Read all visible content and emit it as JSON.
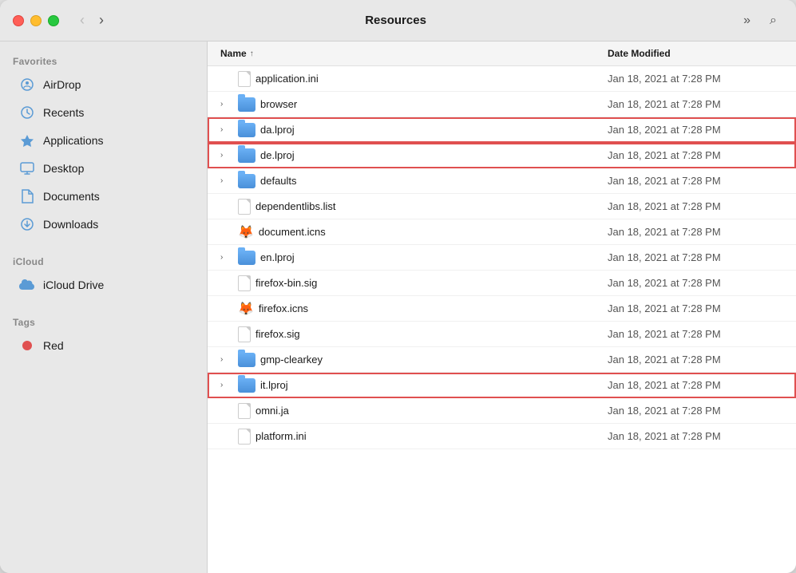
{
  "window": {
    "title": "Resources",
    "traffic_lights": {
      "close": "close",
      "minimize": "minimize",
      "maximize": "maximize"
    }
  },
  "titlebar": {
    "back_label": "‹",
    "forward_label": "›",
    "title": "Resources",
    "more_label": "»",
    "search_label": "⌕"
  },
  "sidebar": {
    "favorites_label": "Favorites",
    "icloud_label": "iCloud",
    "tags_label": "Tags",
    "items": [
      {
        "id": "airdrop",
        "label": "AirDrop",
        "icon": "airdrop"
      },
      {
        "id": "recents",
        "label": "Recents",
        "icon": "recents"
      },
      {
        "id": "applications",
        "label": "Applications",
        "icon": "applications"
      },
      {
        "id": "desktop",
        "label": "Desktop",
        "icon": "desktop"
      },
      {
        "id": "documents",
        "label": "Documents",
        "icon": "documents"
      },
      {
        "id": "downloads",
        "label": "Downloads",
        "icon": "downloads"
      }
    ],
    "icloud_items": [
      {
        "id": "icloud-drive",
        "label": "iCloud Drive",
        "icon": "icloud"
      }
    ],
    "tag_items": [
      {
        "id": "red",
        "label": "Red",
        "icon": "red-dot"
      }
    ]
  },
  "file_list": {
    "col_name": "Name",
    "col_date": "Date Modified",
    "sort_indicator": "↑",
    "rows": [
      {
        "id": 1,
        "name": "application.ini",
        "type": "doc",
        "expandable": false,
        "date": "Jan 18, 2021 at 7:28 PM",
        "highlighted": false
      },
      {
        "id": 2,
        "name": "browser",
        "type": "folder",
        "expandable": true,
        "date": "Jan 18, 2021 at 7:28 PM",
        "highlighted": false
      },
      {
        "id": 3,
        "name": "da.lproj",
        "type": "folder",
        "expandable": true,
        "date": "Jan 18, 2021 at 7:28 PM",
        "highlighted": true
      },
      {
        "id": 4,
        "name": "de.lproj",
        "type": "folder",
        "expandable": true,
        "date": "Jan 18, 2021 at 7:28 PM",
        "highlighted": true
      },
      {
        "id": 5,
        "name": "defaults",
        "type": "folder",
        "expandable": true,
        "date": "Jan 18, 2021 at 7:28 PM",
        "highlighted": false
      },
      {
        "id": 6,
        "name": "dependentlibs.list",
        "type": "doc",
        "expandable": false,
        "date": "Jan 18, 2021 at 7:28 PM",
        "highlighted": false
      },
      {
        "id": 7,
        "name": "document.icns",
        "type": "firefox",
        "expandable": false,
        "date": "Jan 18, 2021 at 7:28 PM",
        "highlighted": false
      },
      {
        "id": 8,
        "name": "en.lproj",
        "type": "folder",
        "expandable": true,
        "date": "Jan 18, 2021 at 7:28 PM",
        "highlighted": false
      },
      {
        "id": 9,
        "name": "firefox-bin.sig",
        "type": "doc",
        "expandable": false,
        "date": "Jan 18, 2021 at 7:28 PM",
        "highlighted": false
      },
      {
        "id": 10,
        "name": "firefox.icns",
        "type": "firefox",
        "expandable": false,
        "date": "Jan 18, 2021 at 7:28 PM",
        "highlighted": false
      },
      {
        "id": 11,
        "name": "firefox.sig",
        "type": "doc",
        "expandable": false,
        "date": "Jan 18, 2021 at 7:28 PM",
        "highlighted": false
      },
      {
        "id": 12,
        "name": "gmp-clearkey",
        "type": "folder",
        "expandable": true,
        "date": "Jan 18, 2021 at 7:28 PM",
        "highlighted": false
      },
      {
        "id": 13,
        "name": "it.lproj",
        "type": "folder",
        "expandable": true,
        "date": "Jan 18, 2021 at 7:28 PM",
        "highlighted": true
      },
      {
        "id": 14,
        "name": "omni.ja",
        "type": "doc",
        "expandable": false,
        "date": "Jan 18, 2021 at 7:28 PM",
        "highlighted": false
      },
      {
        "id": 15,
        "name": "platform.ini",
        "type": "doc",
        "expandable": false,
        "date": "Jan 18, 2021 at 7:28 PM",
        "highlighted": false
      }
    ]
  }
}
